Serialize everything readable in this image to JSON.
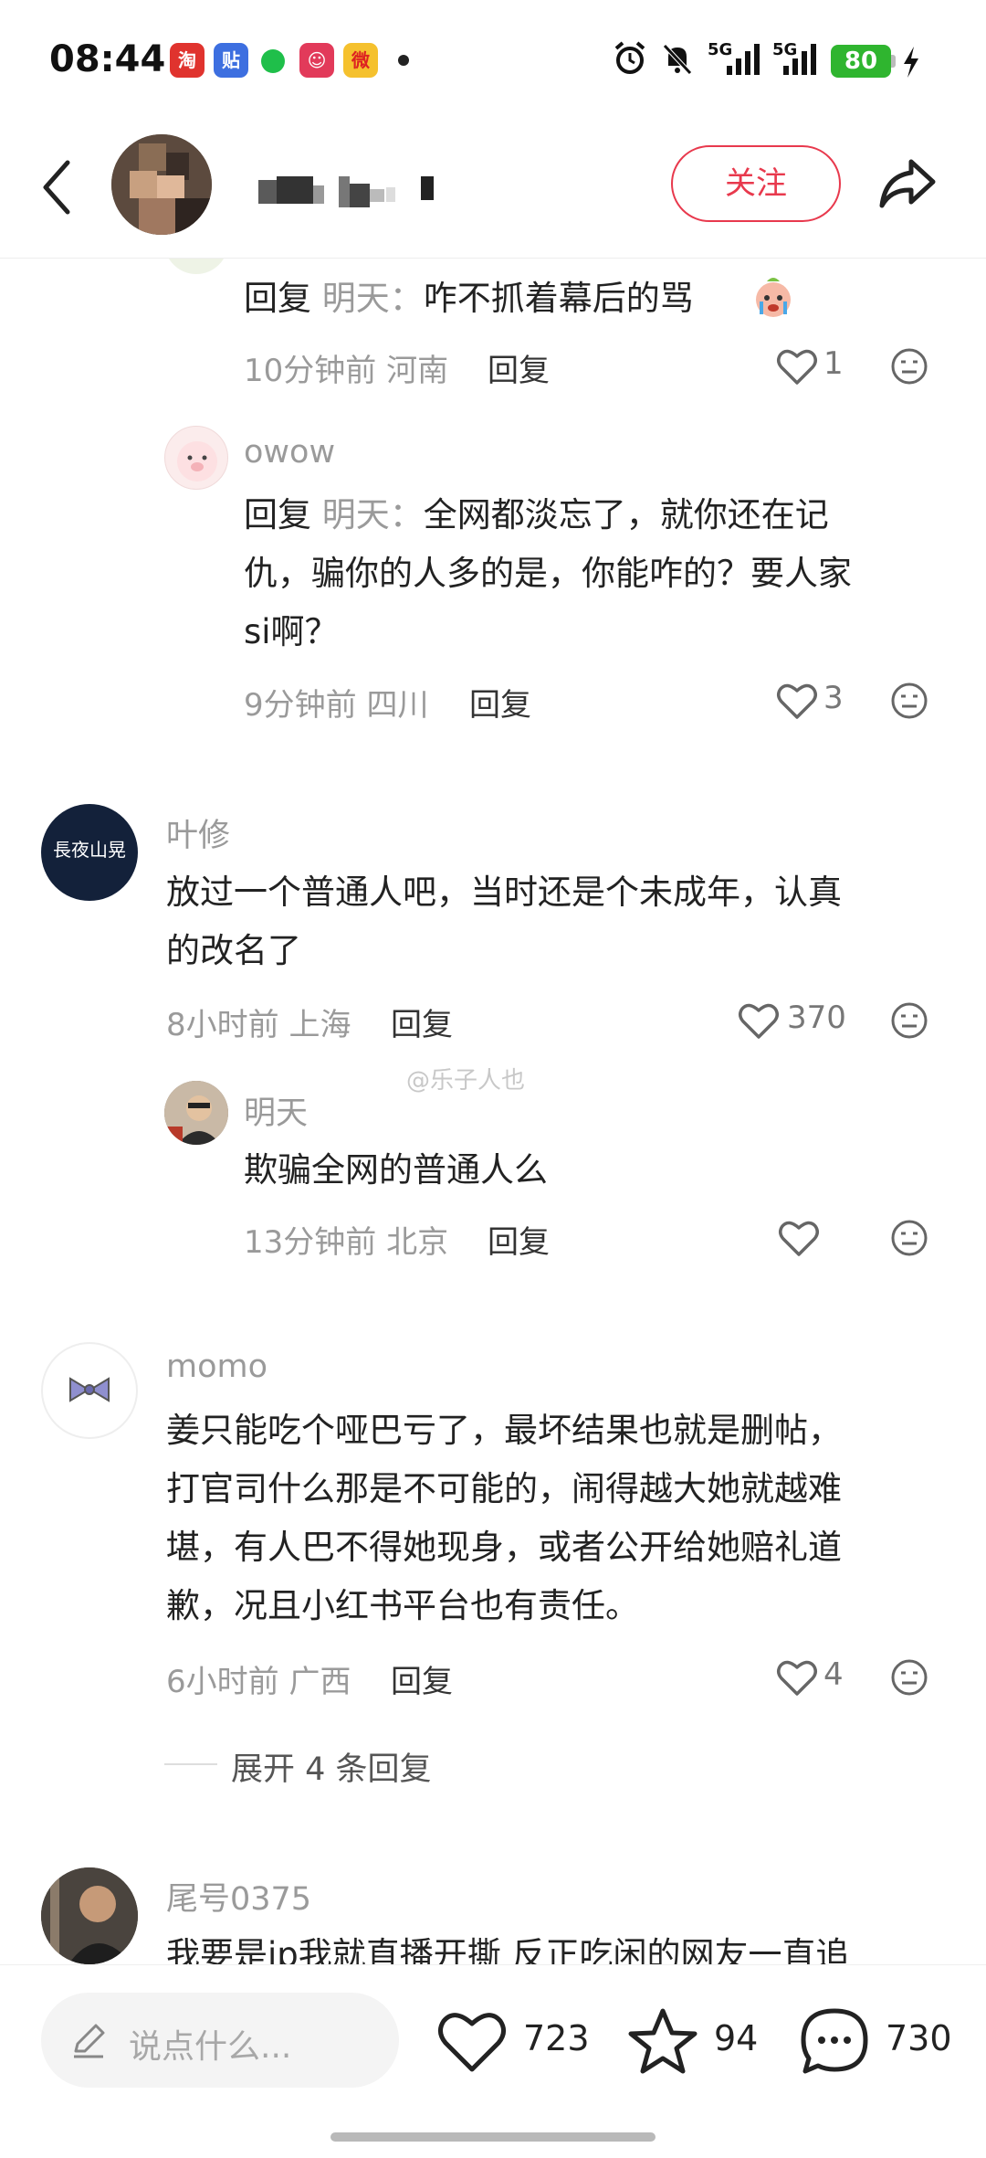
{
  "status_bar": {
    "time": "08:44",
    "apps": [
      "taobao-app-icon",
      "tieba-app-icon",
      "wechat-app-icon",
      "store-app-icon",
      "weibo-app-icon"
    ],
    "app_labels": [
      "淘",
      "贴",
      "",
      "☺",
      "微"
    ],
    "signal1": "5G",
    "signal2": "5G",
    "battery": "80"
  },
  "header": {
    "follow_label": "关注"
  },
  "comments": [
    {
      "id": "c1",
      "reply_prefix": "回复",
      "reply_to": "明天：",
      "text": "咋不抓着幕后的骂",
      "time": "10分钟前",
      "location": "河南",
      "reply_label": "回复",
      "likes": "1"
    },
    {
      "id": "c2",
      "name": "owow",
      "reply_prefix": "回复",
      "reply_to": "明天：",
      "text_line1": "全网都淡忘了，就你还在记",
      "text_line2": "仇，骗你的人多的是，你能咋的？要人家",
      "text_line3": "si啊？",
      "time": "9分钟前",
      "location": "四川",
      "reply_label": "回复",
      "likes": "3"
    },
    {
      "id": "c3",
      "name": "叶修",
      "avatar_text": "長夜山晃",
      "text_line1": "放过一个普通人吧，当时还是个未成年，认真",
      "text_line2": "的改名了",
      "time": "8小时前",
      "location": "上海",
      "reply_label": "回复",
      "likes": "370"
    },
    {
      "id": "c4",
      "name": "明天",
      "text": "欺骗全网的普通人么",
      "time": "13分钟前",
      "location": "北京",
      "reply_label": "回复"
    },
    {
      "id": "c5",
      "name": "momo",
      "text_line1": "姜只能吃个哑巴亏了，最坏结果也就是删帖，",
      "text_line2": "打官司什么那是不可能的，闹得越大她就越难",
      "text_line3": "堪，有人巴不得她现身，或者公开给她赔礼道",
      "text_line4": "歉，况且小红书平台也有责任。",
      "time": "6小时前",
      "location": "广西",
      "reply_label": "回复",
      "likes": "4",
      "expand_label": "展开 4 条回复"
    },
    {
      "id": "c6",
      "name": "尾号0375",
      "text_partial": "我要是ip我就直播开撕 反正吃闲的网友一直追"
    }
  ],
  "watermark": "@乐子人也",
  "bottom_bar": {
    "input_placeholder": "说点什么...",
    "likes": "723",
    "stars": "94",
    "comments": "730"
  },
  "colors": {
    "accent": "#e8394d",
    "muted_text": "#9a9a9a",
    "battery": "#2fb52f"
  }
}
